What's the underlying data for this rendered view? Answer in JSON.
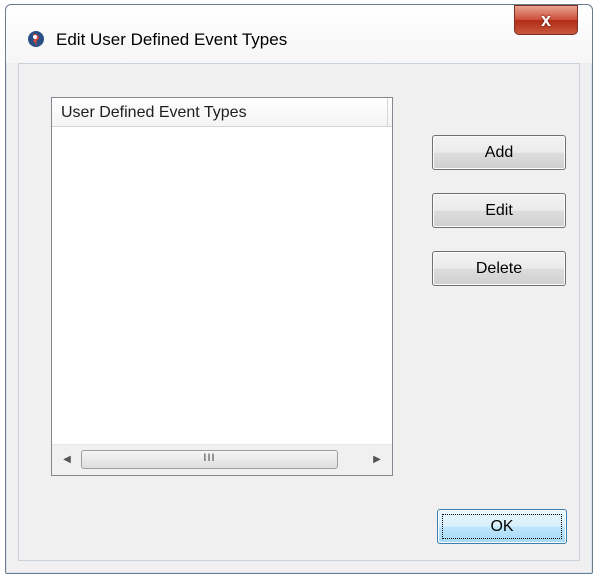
{
  "window": {
    "title": "Edit User Defined Event Types",
    "close_label": "x"
  },
  "list": {
    "header": "User Defined Event Types",
    "items": [],
    "scroll_thumb_grip": "III"
  },
  "buttons": {
    "add": "Add",
    "edit": "Edit",
    "delete": "Delete",
    "ok": "OK"
  },
  "icons": {
    "app": "app-logo-icon",
    "close": "close-icon",
    "scroll_left": "scroll-left-arrow-icon",
    "scroll_right": "scroll-right-arrow-icon"
  },
  "colors": {
    "close_button": "#c8412b",
    "ok_button_border": "#3c7fb1"
  }
}
